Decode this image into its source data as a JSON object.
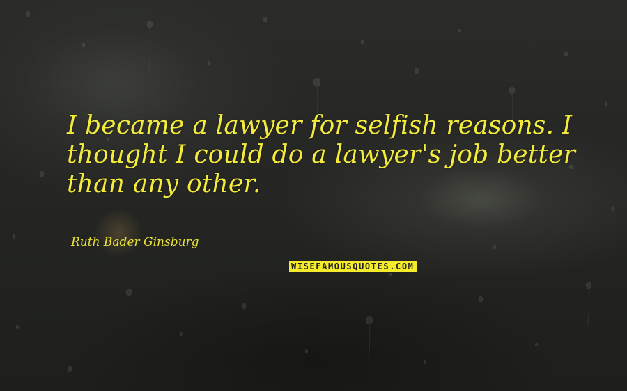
{
  "quote": {
    "text": "I became a lawyer for selfish reasons. I thought I could do a lawyer's job better than any other.",
    "color": "#f4ec3c"
  },
  "author": {
    "name": "Ruth Bader Ginsburg"
  },
  "brand": {
    "logo_text": "WISEFAMOUSQUOTES.COM",
    "background_color": "#f4ec2a"
  },
  "background": {
    "description_icon": "rain-window-icon",
    "base_color": "#222320"
  }
}
